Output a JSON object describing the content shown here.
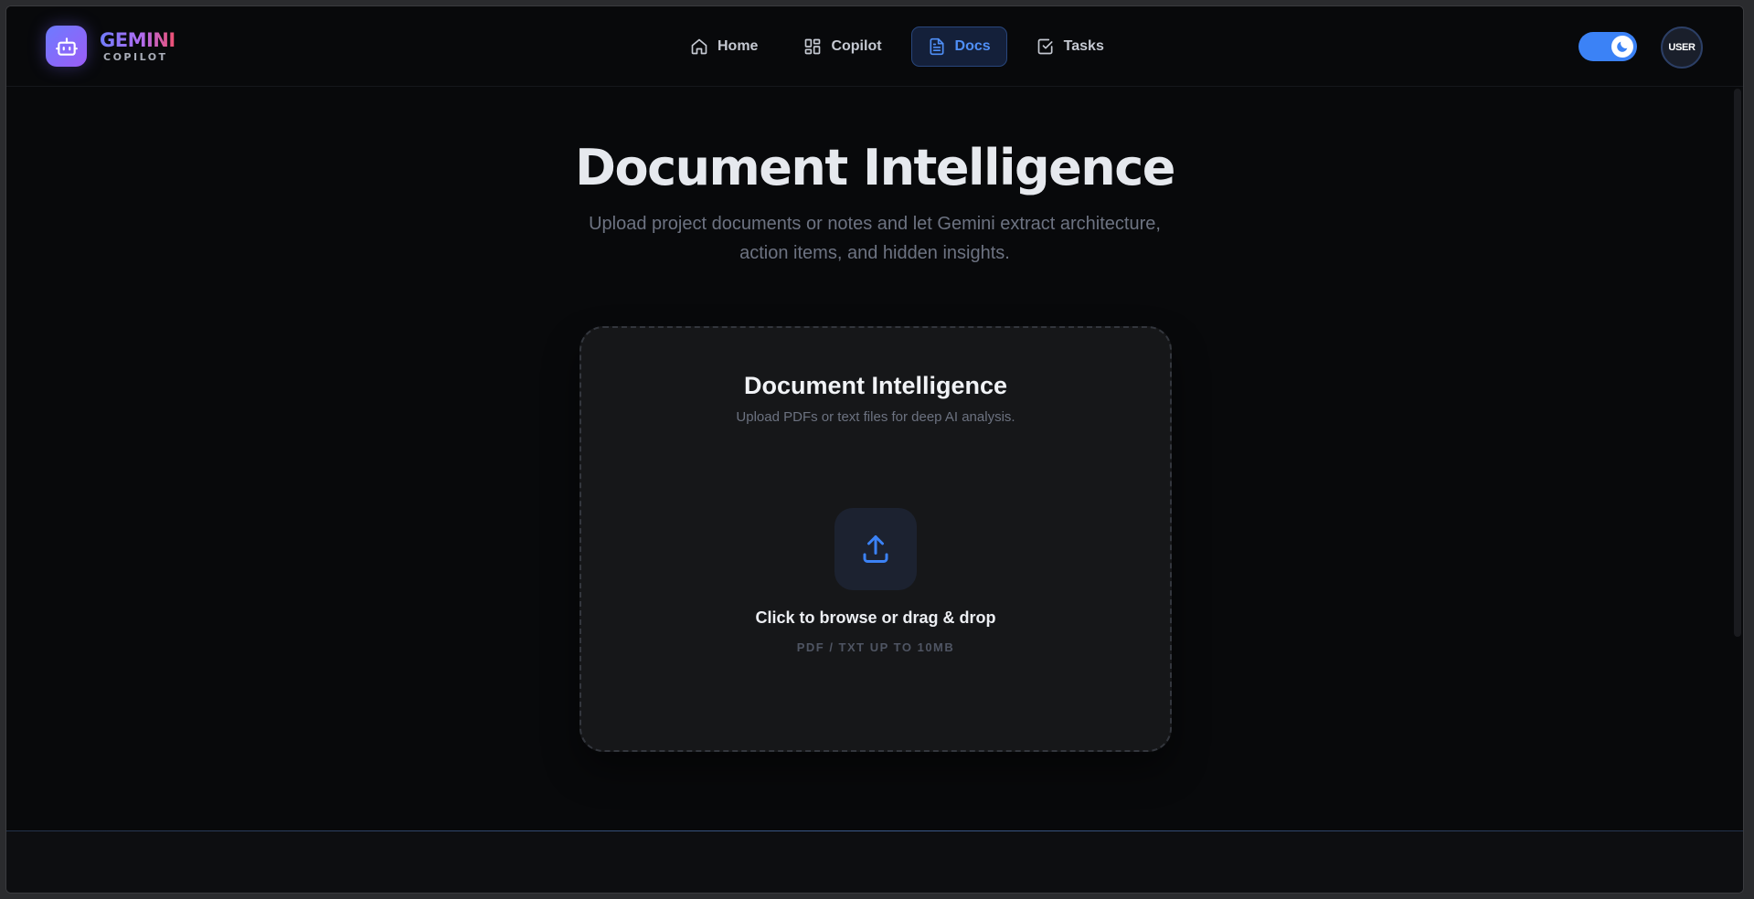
{
  "brand": {
    "title": "GEMINI",
    "subtitle": "COPILOT"
  },
  "nav": {
    "items": [
      {
        "label": "Home",
        "icon": "home-icon"
      },
      {
        "label": "Copilot",
        "icon": "grid-icon"
      },
      {
        "label": "Docs",
        "icon": "document-icon",
        "active": true
      },
      {
        "label": "Tasks",
        "icon": "checkbox-icon"
      }
    ]
  },
  "user": {
    "avatar_label": "USER"
  },
  "hero": {
    "title": "Document Intelligence",
    "subtitle": "Upload project documents or notes and let Gemini extract architecture, action items, and hidden insights."
  },
  "card": {
    "title": "Document Intelligence",
    "subtitle": "Upload PDFs or text files for deep AI analysis.",
    "upload_label": "Click to browse or drag & drop",
    "upload_hint": "PDF / TXT UP TO 10MB"
  },
  "colors": {
    "accent": "#3b82f6",
    "background": "#08090b",
    "card": "#161719"
  }
}
